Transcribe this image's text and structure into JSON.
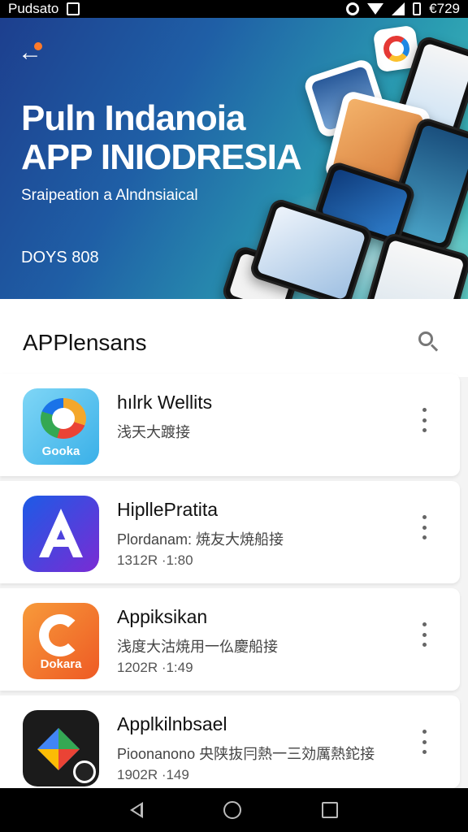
{
  "status_bar": {
    "carrier": "Pudsato",
    "clock": "€729"
  },
  "hero": {
    "title_line1": "Puln Indanoia",
    "title_line2": "APP INIODRESIA",
    "subtitle": "Sraipeation a Alndnsiaical",
    "tag": "DOYS 808"
  },
  "list": {
    "section_title": "APPlensans",
    "apps": [
      {
        "name": "hılrk Wellits",
        "desc": "浅天大踱接",
        "meta": "",
        "icon_label": "Gooka"
      },
      {
        "name": "HipllePratita",
        "desc": "Plordanam: 焼友大焼船接",
        "meta": "1312R ·1:80",
        "icon_label": ""
      },
      {
        "name": "Appiksikan",
        "desc": "浅度大沽焼用一仫慶船接",
        "meta": "1202R ·1:49",
        "icon_label": "Dokara"
      },
      {
        "name": "Applkilnbsael",
        "desc": "Pioonanono 央陕抜冃熱一三効厲熱鉈接",
        "meta": "1902R ·149",
        "icon_label": ""
      }
    ]
  },
  "colors": {
    "hero_start": "#1d3f8e",
    "hero_end": "#4cc7bf",
    "accent_dot": "#ff7a2a"
  }
}
